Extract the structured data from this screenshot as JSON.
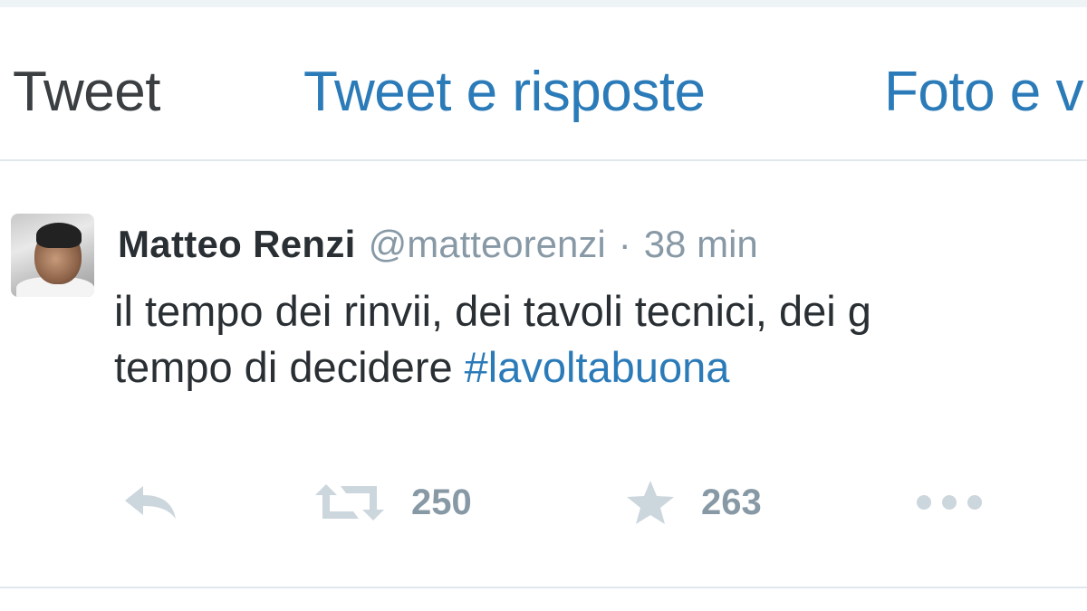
{
  "tabs": {
    "tweet": "Tweet",
    "replies": "Tweet e risposte",
    "photos": "Foto e v"
  },
  "tweet": {
    "author_name": "Matteo Renzi",
    "handle": "@matteorenzi",
    "separator": "·",
    "time": "38 min",
    "text_line1": "il tempo dei rinvii, dei tavoli tecnici, dei g",
    "text_line2": "tempo di decidere ",
    "hashtag": "#lavoltabuona",
    "retweet_count": "250",
    "favorite_count": "263"
  },
  "icons": {
    "reply": "reply-icon",
    "retweet": "retweet-icon",
    "favorite": "star-icon",
    "more": "more-icon"
  },
  "colors": {
    "link": "#2b7bb9",
    "text": "#292f33",
    "muted": "#8899a6",
    "icon": "#ccd6dd"
  }
}
